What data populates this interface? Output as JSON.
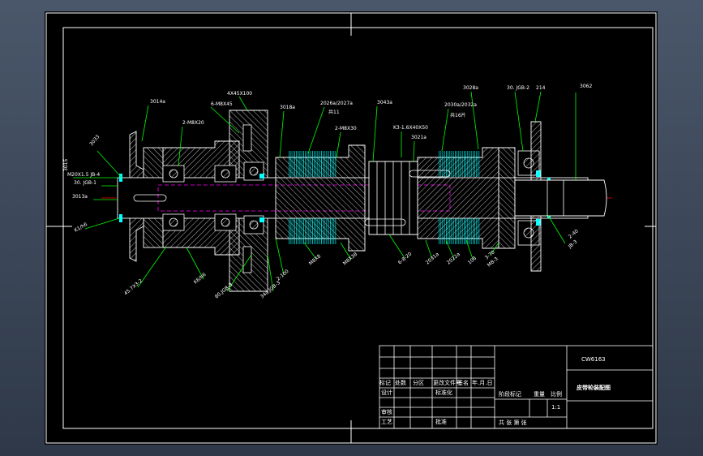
{
  "title_block": {
    "drawing_number": "CW6163",
    "drawing_title": "皮带轮装配图",
    "header_cells": [
      "标记",
      "处数",
      "分区",
      "更改文件号",
      "签名",
      "年.月.日"
    ],
    "row_design": "设计",
    "row_check": "审核",
    "row_process": "工艺",
    "row_standard": "标准化",
    "row_approve": "批准",
    "stage_mark": "阶段标记",
    "weight": "重量",
    "scale": "比例",
    "scale_value": "1:1",
    "sheets": "共  张  第  张"
  },
  "leaders": [
    {
      "id": "l01",
      "text": "3014a"
    },
    {
      "id": "l02",
      "text": "2-M8X20"
    },
    {
      "id": "l03",
      "text": "6-M8X45"
    },
    {
      "id": "l04",
      "text": "4X45X100"
    },
    {
      "id": "l05",
      "text": "3018a"
    },
    {
      "id": "l06",
      "text": "2026a/2027a"
    },
    {
      "id": "l07",
      "text": "共11"
    },
    {
      "id": "l08",
      "text": "3043a"
    },
    {
      "id": "l09",
      "text": "2030a/2032a"
    },
    {
      "id": "l10",
      "text": "共16片"
    },
    {
      "id": "l11",
      "text": "3028a"
    },
    {
      "id": "l12",
      "text": "30. JGB-2"
    },
    {
      "id": "l13",
      "text": "214"
    },
    {
      "id": "l14",
      "text": "3062"
    },
    {
      "id": "l15",
      "text": "3033"
    },
    {
      "id": "l16",
      "text": "2-M8X30"
    },
    {
      "id": "l17",
      "text": "3021a"
    },
    {
      "id": "l18",
      "text": "K3-1.6X40X50"
    },
    {
      "id": "l19",
      "text": "3015"
    },
    {
      "id": "l20",
      "text": "M20X1.5 JB-4"
    },
    {
      "id": "l21",
      "text": "30. JGB-1"
    },
    {
      "id": "l22",
      "text": "3013a"
    },
    {
      "id": "l23",
      "text": "K1/h6"
    },
    {
      "id": "l24",
      "text": "45.7X3-2"
    },
    {
      "id": "l25",
      "text": "K6/h6"
    },
    {
      "id": "l26",
      "text": "80.JGB-3"
    },
    {
      "id": "l27",
      "text": "34a.JGB-3"
    },
    {
      "id": "l28",
      "text": "2-100"
    },
    {
      "id": "l29",
      "text": "M8X8"
    },
    {
      "id": "l30",
      "text": "M8X38"
    },
    {
      "id": "l31",
      "text": "6-8-20"
    },
    {
      "id": "l32",
      "text": "2031a"
    },
    {
      "id": "l33",
      "text": "2022a"
    },
    {
      "id": "l34",
      "text": "108"
    },
    {
      "id": "l35",
      "text": "3-70"
    },
    {
      "id": "l36",
      "text": "M8-3"
    },
    {
      "id": "l37",
      "text": "2-40"
    },
    {
      "id": "l38",
      "text": "JB-3"
    }
  ],
  "colors": {
    "frame": "#ffffff",
    "outline": "#ffffff",
    "hatch": "#ffffff",
    "leader": "#00ff00",
    "centerline": "#ff0000",
    "hidden": "#ff00ff",
    "gear": "#00ffff",
    "fill": "#b4a88c",
    "background": "#000000"
  }
}
